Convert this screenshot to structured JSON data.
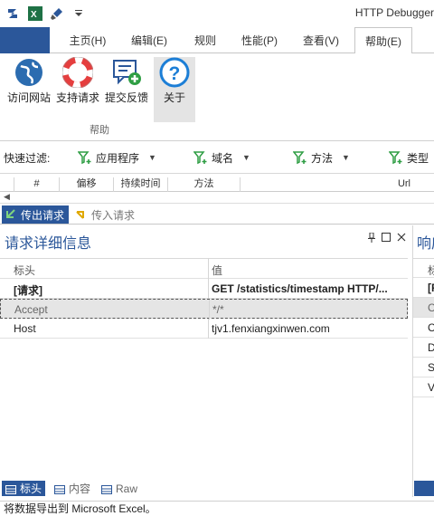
{
  "window": {
    "title": "HTTP Debugger"
  },
  "tabs": [
    {
      "label": "主页(H)"
    },
    {
      "label": "编辑(E)"
    },
    {
      "label": "规则"
    },
    {
      "label": "性能(P)"
    },
    {
      "label": "查看(V)"
    },
    {
      "label": "帮助(E)"
    }
  ],
  "ribbon": {
    "buttons": [
      {
        "label": "访问网站",
        "icon": "globe-icon"
      },
      {
        "label": "支持请求",
        "icon": "lifebuoy-icon"
      },
      {
        "label": "提交反馈",
        "icon": "feedback-icon"
      },
      {
        "label": "关于",
        "icon": "help-icon"
      }
    ],
    "group_label": "帮助"
  },
  "filter": {
    "label": "快速过滤:",
    "buttons": [
      {
        "label": "应用程序"
      },
      {
        "label": "域名"
      },
      {
        "label": "方法"
      },
      {
        "label": "类型"
      }
    ]
  },
  "grid": {
    "columns": [
      "#",
      "偏移",
      "持续时间",
      "方法",
      "Url"
    ]
  },
  "subtabs": {
    "outgoing": "传出请求",
    "incoming": "传入请求"
  },
  "details": {
    "title": "请求详细信息",
    "col_header": "标头",
    "col_value": "值",
    "rows": [
      {
        "header": "[请求]",
        "value": "GET /statistics/timestamp HTTP/..."
      },
      {
        "header": "Accept",
        "value": "*/*"
      },
      {
        "header": "Host",
        "value": "tjv1.fenxiangxinwen.com"
      }
    ],
    "bottom_tabs": [
      "标头",
      "内容",
      "Raw"
    ]
  },
  "response_panel": {
    "title": "响应",
    "col_header": "标",
    "rows": [
      "[R",
      "C",
      "C",
      "D",
      "Se",
      "V"
    ]
  },
  "status": {
    "text": "将数据导出到 Microsoft Excel。"
  },
  "colors": {
    "accent": "#2b579a",
    "green": "#1e7145"
  }
}
